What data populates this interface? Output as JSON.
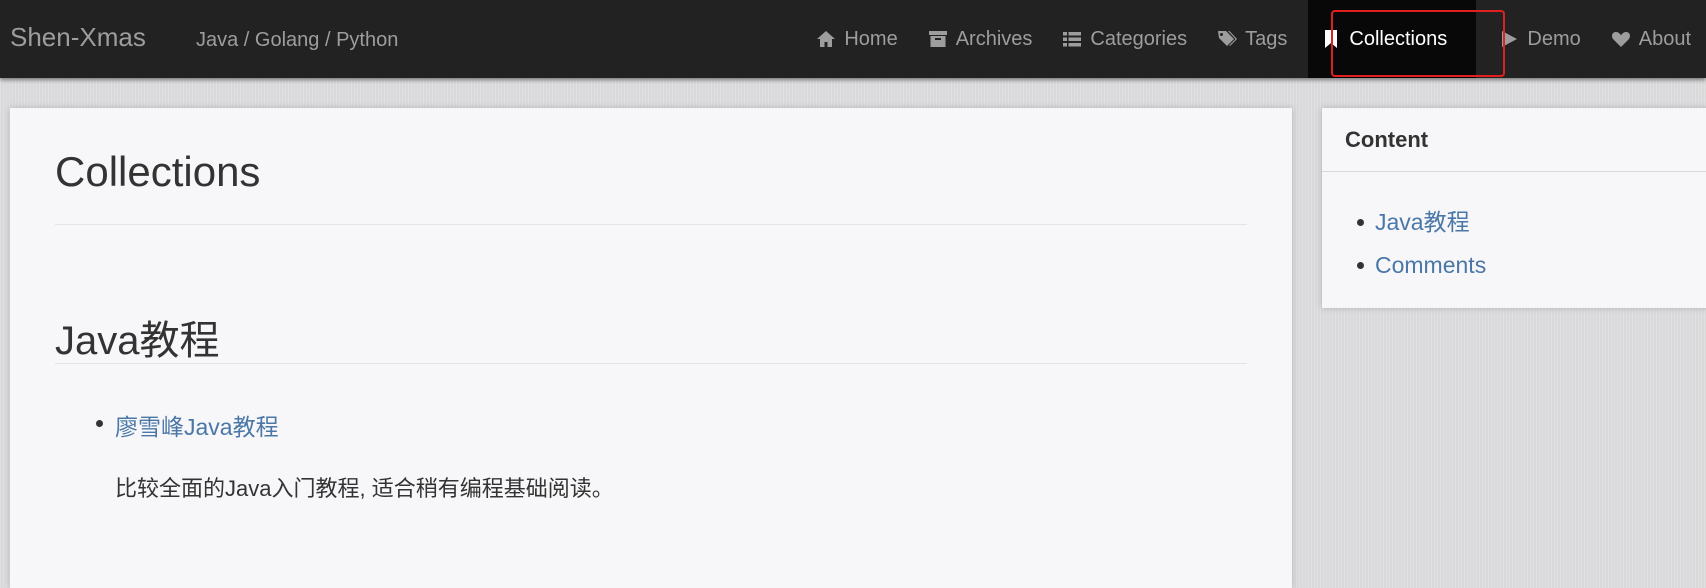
{
  "header": {
    "brand": "Shen-Xmas",
    "tagline": "Java / Golang / Python",
    "nav": [
      {
        "label": "Home",
        "icon": "home-icon"
      },
      {
        "label": "Archives",
        "icon": "archive-icon"
      },
      {
        "label": "Categories",
        "icon": "list-icon"
      },
      {
        "label": "Tags",
        "icon": "tags-icon"
      },
      {
        "label": "Collections",
        "icon": "bookmark-icon",
        "active": true
      },
      {
        "label": "Demo",
        "icon": "play-icon"
      },
      {
        "label": "About",
        "icon": "heart-icon"
      }
    ]
  },
  "main": {
    "title": "Collections",
    "section_title": "Java教程",
    "items": [
      {
        "link": "廖雪峰Java教程",
        "description": "比较全面的Java入门教程, 适合稍有编程基础阅读。"
      }
    ]
  },
  "sidebar": {
    "heading": "Content",
    "links": [
      "Java教程",
      "Comments"
    ]
  },
  "colors": {
    "navbar_bg": "#222222",
    "active_bg": "#080808",
    "highlight_border": "#e02020",
    "link": "#4a77a8"
  }
}
